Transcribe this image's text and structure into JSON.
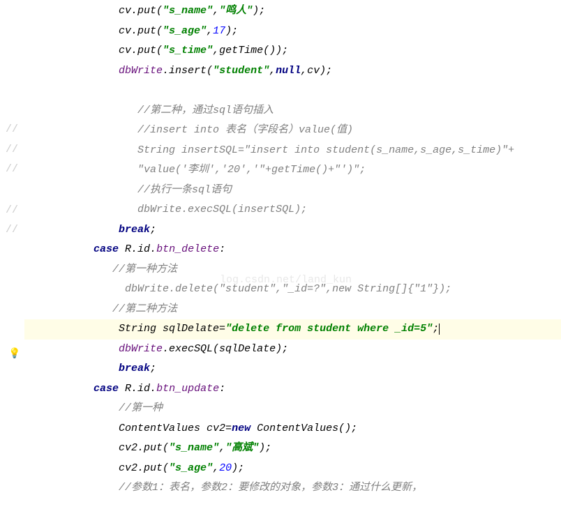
{
  "code": {
    "l1_put1": "cv.put(",
    "l1_s1": "\"s_name\"",
    "l1_c1": ",",
    "l1_s2": "\"鸣人\"",
    "l1_e": ");",
    "l2_put": "cv.put(",
    "l2_s1": "\"s_age\"",
    "l2_c": ",",
    "l2_n": "17",
    "l2_e": ");",
    "l3_put": "cv.put(",
    "l3_s1": "\"s_time\"",
    "l3_c": ",getTime());",
    "l4_a": "dbWrite",
    "l4_b": ".insert(",
    "l4_s": "\"student\"",
    "l4_c": ",",
    "l4_null": "null",
    "l4_e": ",cv);",
    "c1": "//第二种，通过sql语句插入",
    "c2": "//insert into 表名（字段名）value(值)",
    "c3": "String insertSQL=\"insert into student(s_name,s_age,s_time)\"+",
    "c4": "\"value('李圳','20','\"+getTime()+\"')\";",
    "c5": "//执行一条sql语句",
    "c6": "dbWrite.execSQL(insertSQL);",
    "break1": "break",
    "semi": ";",
    "case1": "case",
    "case1_rid": " R.id.",
    "case1_btn": "btn_delete",
    "case1_e": ":",
    "c7": "//第一种方法",
    "c8": "  dbWrite.delete(\"student\",\"_id=?\",new String[]{\"1\"});",
    "c9": "//第二种方法",
    "l5_a": "String sqlDelate=",
    "l5_s": "\"delete from student where _id=5\"",
    "l5_e": ";",
    "l6_a": "dbWrite",
    "l6_b": ".execSQL(sqlDelate);",
    "break2": "break",
    "case2": "case",
    "case2_rid": " R.id.",
    "case2_btn": "btn_update",
    "case2_e": ":",
    "c10": "//第一种",
    "l7_a": "ContentValues cv2=",
    "l7_new": "new",
    "l7_b": " ContentValues();",
    "l8_a": "cv2.put(",
    "l8_s1": "\"s_name\"",
    "l8_c": ",",
    "l8_s2": "\"高斌\"",
    "l8_e": ");",
    "l9_a": "cv2.put(",
    "l9_s1": "\"s_age\"",
    "l9_c": ",",
    "l9_n": "20",
    "l9_e": ");",
    "c11": "//参数1：表名，参数2：要修改的对象，参数3：通过什么更新，"
  },
  "watermark": "log.csdn.net/land_kun",
  "gutter_marks": [
    "//",
    "//",
    "//",
    "//",
    "//",
    "//"
  ],
  "bulb_icon": "💡"
}
